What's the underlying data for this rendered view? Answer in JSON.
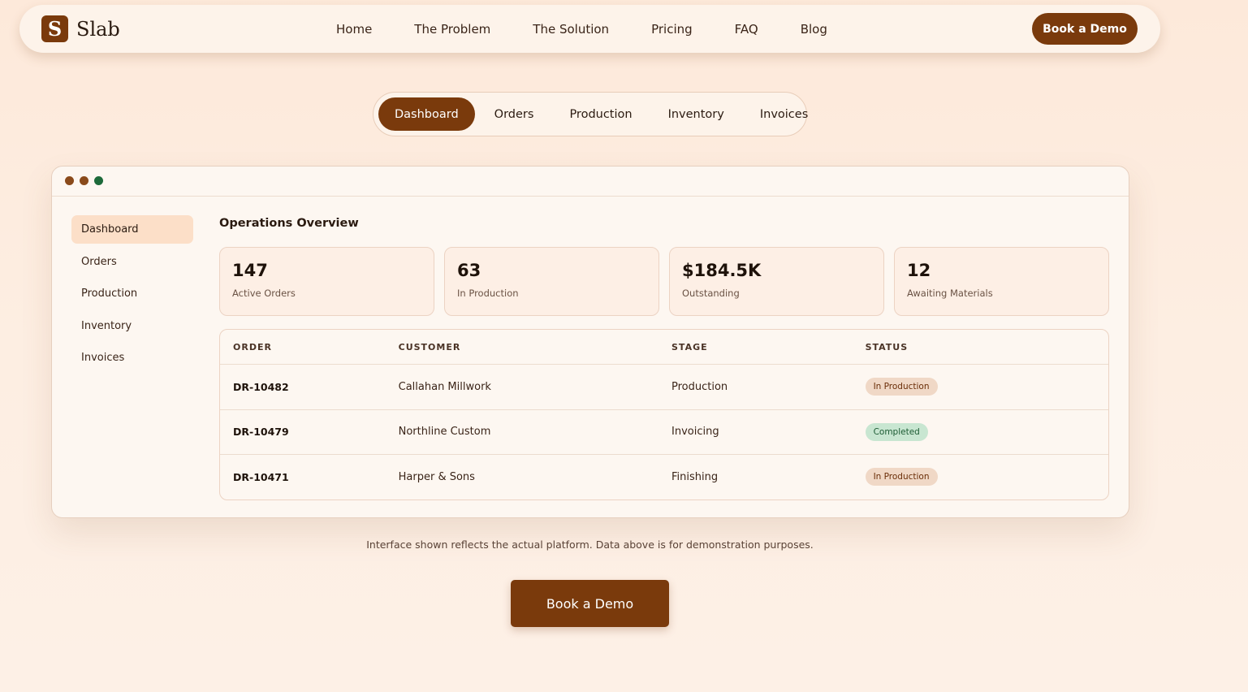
{
  "brand": {
    "logo_letter": "S",
    "name": "Slab"
  },
  "nav": {
    "links": [
      "Home",
      "The Problem",
      "The Solution",
      "Pricing",
      "FAQ",
      "Blog"
    ],
    "cta": "Book a Demo"
  },
  "tabs": [
    "Dashboard",
    "Orders",
    "Production",
    "Inventory",
    "Invoices"
  ],
  "sidebar": [
    "Dashboard",
    "Orders",
    "Production",
    "Inventory",
    "Invoices"
  ],
  "main": {
    "title": "Operations Overview",
    "stats": [
      {
        "value": "147",
        "label": "Active Orders"
      },
      {
        "value": "63",
        "label": "In Production"
      },
      {
        "value": "$184.5K",
        "label": "Outstanding"
      },
      {
        "value": "12",
        "label": "Awaiting Materials"
      }
    ],
    "table": {
      "headers": [
        "ORDER",
        "CUSTOMER",
        "STAGE",
        "STATUS"
      ],
      "rows": [
        {
          "order": "DR-10482",
          "customer": "Callahan Millwork",
          "stage": "Production",
          "status": "In Production"
        },
        {
          "order": "DR-10479",
          "customer": "Northline Custom",
          "stage": "Invoicing",
          "status": "Completed"
        },
        {
          "order": "DR-10471",
          "customer": "Harper & Sons",
          "stage": "Finishing",
          "status": "In Production"
        }
      ]
    }
  },
  "disclaimer": "Interface shown reflects the actual platform. Data above is for demonstration purposes.",
  "cta_bottom": "Book a Demo",
  "colors": {
    "accent": "#7a3a0c",
    "badge_production": "#f0d8c6",
    "badge_completed": "#c8e6d1"
  }
}
